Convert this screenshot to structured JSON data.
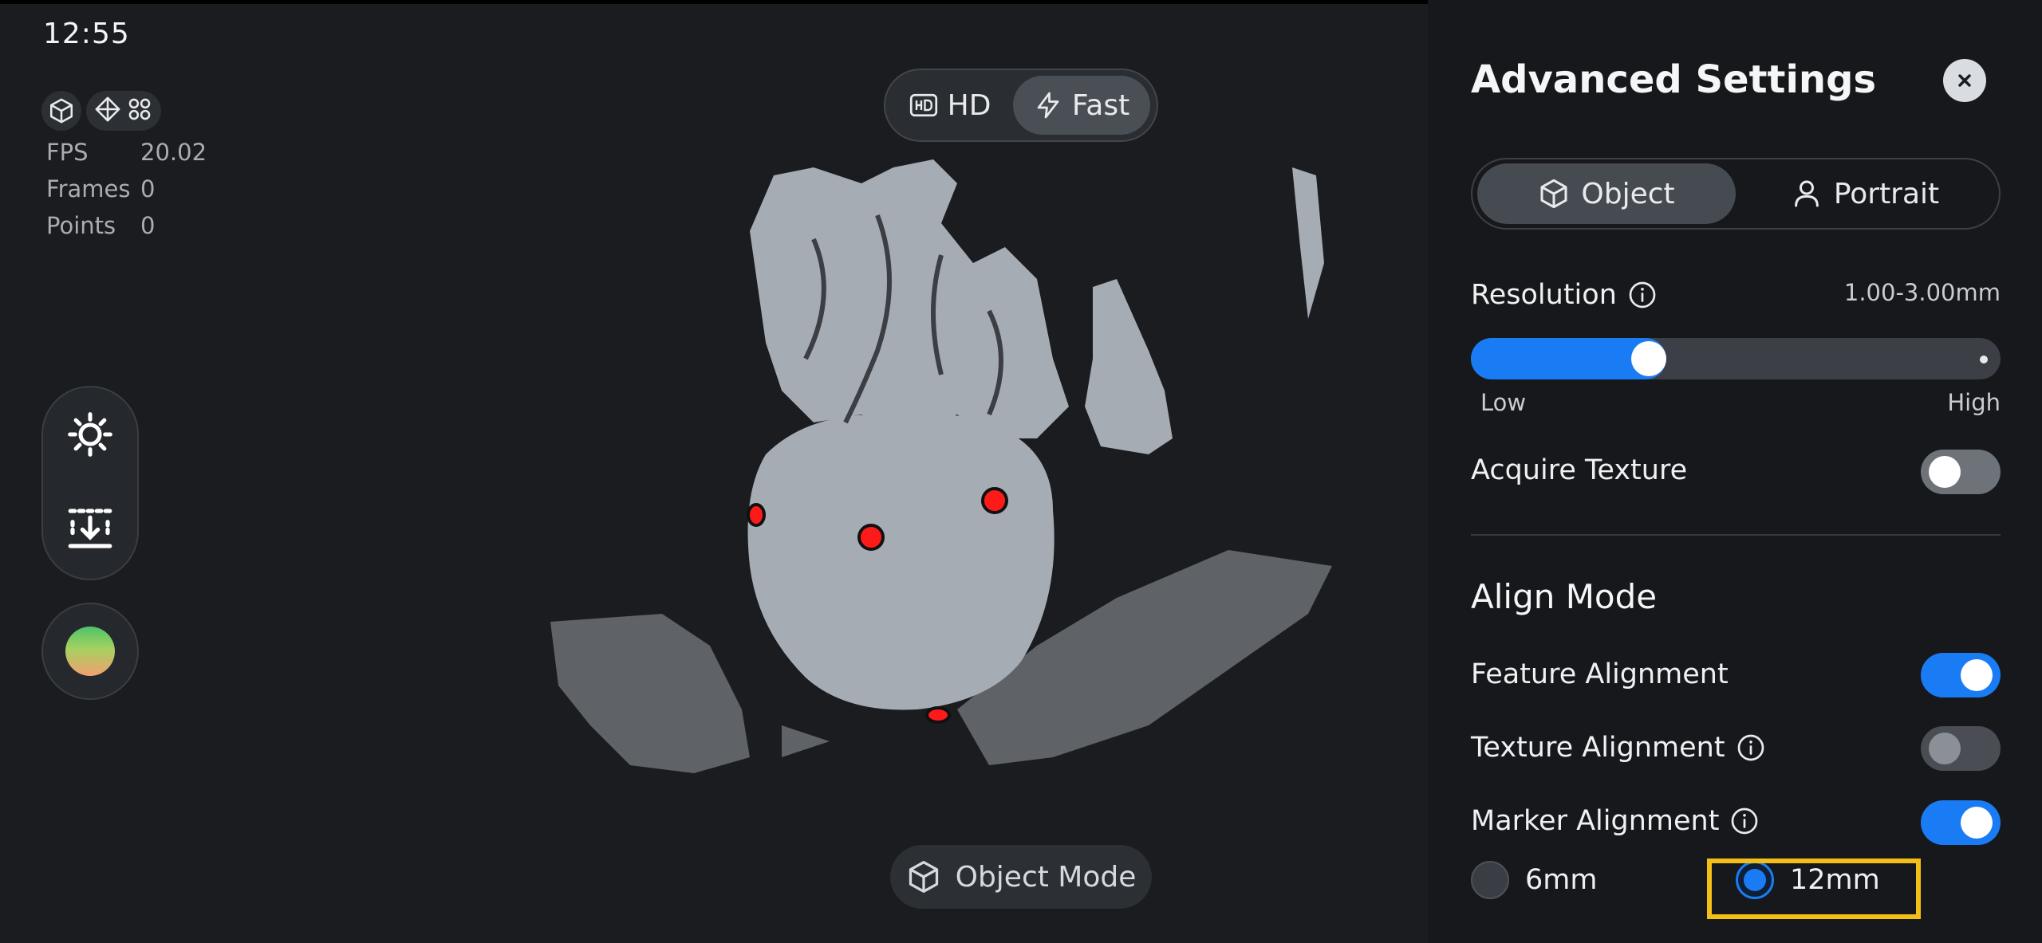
{
  "status": {
    "time": "12:55"
  },
  "viewport": {
    "stats": [
      {
        "label": "FPS",
        "value": "20.02"
      },
      {
        "label": "Frames",
        "value": "0"
      },
      {
        "label": "Points",
        "value": "0"
      }
    ],
    "quality": {
      "hd_label": "HD",
      "fast_label": "Fast",
      "selected": "Fast"
    },
    "mode_label": "Object Mode",
    "icons": [
      "cube-view-icon",
      "diamond-view-icon",
      "grid-dots-icon",
      "brightness-icon",
      "scan-distance-icon",
      "color-ball-icon",
      "lightning-icon",
      "hd-icon"
    ]
  },
  "panel": {
    "title": "Advanced Settings",
    "target": {
      "object_label": "Object",
      "portrait_label": "Portrait",
      "selected": "Object"
    },
    "resolution": {
      "label": "Resolution",
      "range": "1.00-3.00mm",
      "low_label": "Low",
      "high_label": "High",
      "level": 0.33
    },
    "acquire_texture": {
      "label": "Acquire Texture",
      "enabled": false
    },
    "align_mode": {
      "title": "Align Mode",
      "feature": {
        "label": "Feature Alignment",
        "enabled": true
      },
      "texture": {
        "label": "Texture Alignment",
        "enabled": false
      },
      "marker": {
        "label": "Marker Alignment",
        "enabled": true
      },
      "marker_sizes": [
        {
          "label": "6mm",
          "selected": false
        },
        {
          "label": "12mm",
          "selected": true
        }
      ]
    },
    "colors": {
      "accent": "#1a7cf5",
      "highlight": "#f3bf16",
      "panel_bg": "#16181b"
    }
  }
}
